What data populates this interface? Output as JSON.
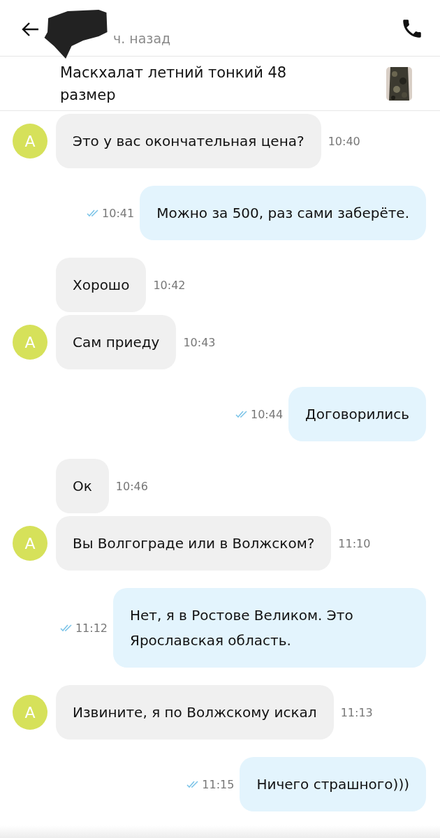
{
  "header": {
    "status": "ч. назад"
  },
  "listing": {
    "title": "Маскхалат летний тонкий 48 размер"
  },
  "messages": [
    {
      "kind": "incoming",
      "avatar": "A",
      "text": "Это у вас окончательная цена?",
      "time": "10:40"
    },
    {
      "kind": "outgoing",
      "text": "Можно за 500, раз сами заберёте.",
      "time": "10:41",
      "read": true
    },
    {
      "kind": "incoming",
      "text": "Хорошо",
      "time": "10:42"
    },
    {
      "kind": "incoming",
      "avatar": "A",
      "text": "Сам приеду",
      "time": "10:43"
    },
    {
      "kind": "outgoing",
      "text": "Договорились",
      "time": "10:44",
      "read": true
    },
    {
      "kind": "incoming",
      "text": "Ок",
      "time": "10:46"
    },
    {
      "kind": "incoming",
      "avatar": "A",
      "text": "Вы Волгограде или в Волжском?",
      "time": "11:10"
    },
    {
      "kind": "outgoing",
      "text": "Нет, я в Ростове Великом. Это Ярославская область.",
      "time": "11:12",
      "read": true
    },
    {
      "kind": "incoming",
      "avatar": "A",
      "text": "Извините, я по Волжскому искал",
      "time": "11:13"
    },
    {
      "kind": "outgoing",
      "text": "Ничего страшного)))",
      "time": "11:15",
      "read": true
    }
  ]
}
